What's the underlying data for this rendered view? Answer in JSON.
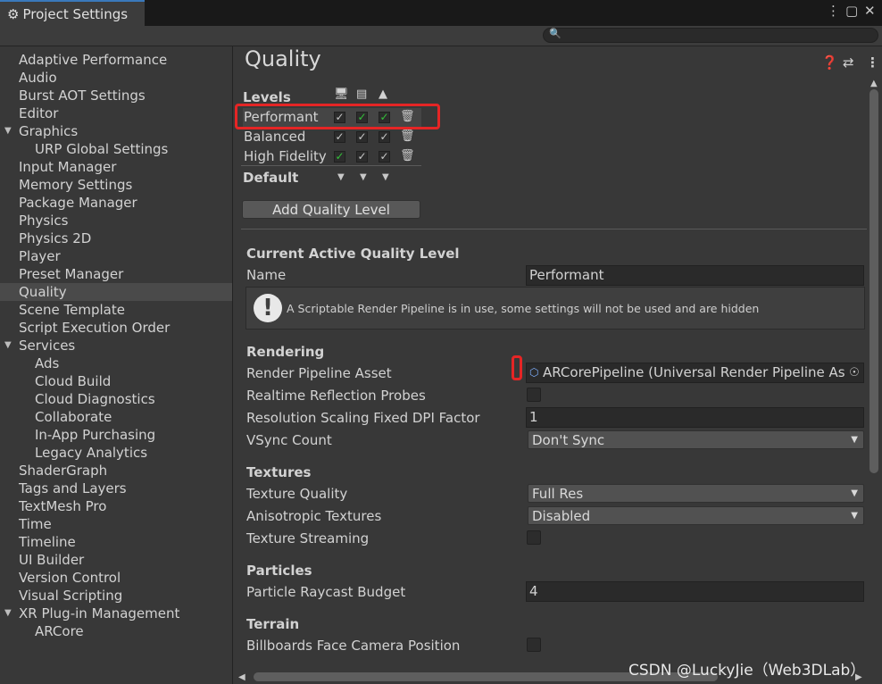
{
  "window": {
    "tab_title": "Project Settings",
    "tab_icon": "gear-icon",
    "menu_icon": "⋮",
    "maximize_icon": "▢",
    "close_icon": "✕"
  },
  "search": {
    "icon": "🔍",
    "placeholder": ""
  },
  "sidebar": {
    "items": [
      {
        "label": "Adaptive Performance"
      },
      {
        "label": "Audio"
      },
      {
        "label": "Burst AOT Settings"
      },
      {
        "label": "Editor"
      },
      {
        "label": "Graphics",
        "expandable": true
      },
      {
        "label": "URP Global Settings",
        "child": true
      },
      {
        "label": "Input Manager"
      },
      {
        "label": "Memory Settings"
      },
      {
        "label": "Package Manager"
      },
      {
        "label": "Physics"
      },
      {
        "label": "Physics 2D"
      },
      {
        "label": "Player"
      },
      {
        "label": "Preset Manager"
      },
      {
        "label": "Quality",
        "selected": true
      },
      {
        "label": "Scene Template"
      },
      {
        "label": "Script Execution Order"
      },
      {
        "label": "Services",
        "expandable": true
      },
      {
        "label": "Ads",
        "child": true
      },
      {
        "label": "Cloud Build",
        "child": true
      },
      {
        "label": "Cloud Diagnostics",
        "child": true
      },
      {
        "label": "Collaborate",
        "child": true
      },
      {
        "label": "In-App Purchasing",
        "child": true
      },
      {
        "label": "Legacy Analytics",
        "child": true
      },
      {
        "label": "ShaderGraph"
      },
      {
        "label": "Tags and Layers"
      },
      {
        "label": "TextMesh Pro"
      },
      {
        "label": "Time"
      },
      {
        "label": "Timeline"
      },
      {
        "label": "UI Builder"
      },
      {
        "label": "Version Control"
      },
      {
        "label": "Visual Scripting"
      },
      {
        "label": "XR Plug-in Management",
        "expandable": true
      },
      {
        "label": "ARCore",
        "child": true
      }
    ]
  },
  "main": {
    "title": "Quality",
    "header_icons": [
      "help-icon",
      "preset-icon",
      "more-icon"
    ],
    "levels": {
      "label": "Levels",
      "platform_icons": [
        "standalone-icon",
        "server-icon",
        "android-icon"
      ],
      "rows": [
        {
          "name": "Performant",
          "checks": [
            {
              "on": true,
              "green": false
            },
            {
              "on": true,
              "green": true
            },
            {
              "on": true,
              "green": true
            }
          ]
        },
        {
          "name": "Balanced",
          "checks": [
            {
              "on": true,
              "green": false
            },
            {
              "on": true,
              "green": false
            },
            {
              "on": true,
              "green": false
            }
          ]
        },
        {
          "name": "High Fidelity",
          "checks": [
            {
              "on": true,
              "green": true
            },
            {
              "on": true,
              "green": false
            },
            {
              "on": true,
              "green": false
            }
          ]
        }
      ],
      "default_label": "Default",
      "add_button": "Add Quality Level"
    },
    "current": {
      "header": "Current Active Quality Level",
      "name_label": "Name",
      "name_value": "Performant",
      "info_text": "A Scriptable Render Pipeline is in use, some settings will not be used and are hidden"
    },
    "rendering": {
      "header": "Rendering",
      "pipeline_label": "Render Pipeline Asset",
      "pipeline_value": "ARCorePipeline (Universal Render Pipeline Asset)",
      "reflection_label": "Realtime Reflection Probes",
      "dpi_label": "Resolution Scaling Fixed DPI Factor",
      "dpi_value": "1",
      "vsync_label": "VSync Count",
      "vsync_value": "Don't Sync"
    },
    "textures": {
      "header": "Textures",
      "quality_label": "Texture Quality",
      "quality_value": "Full Res",
      "aniso_label": "Anisotropic Textures",
      "aniso_value": "Disabled",
      "streaming_label": "Texture Streaming"
    },
    "particles": {
      "header": "Particles",
      "raycast_label": "Particle Raycast Budget",
      "raycast_value": "4"
    },
    "terrain": {
      "header": "Terrain",
      "billboards_label": "Billboards Face Camera Position"
    }
  },
  "watermark": "CSDN @LuckyJie（Web3DLab）",
  "colors": {
    "highlight_red": "#e52525",
    "check_green": "#34c23a",
    "accent_blue": "#3a79bb"
  }
}
